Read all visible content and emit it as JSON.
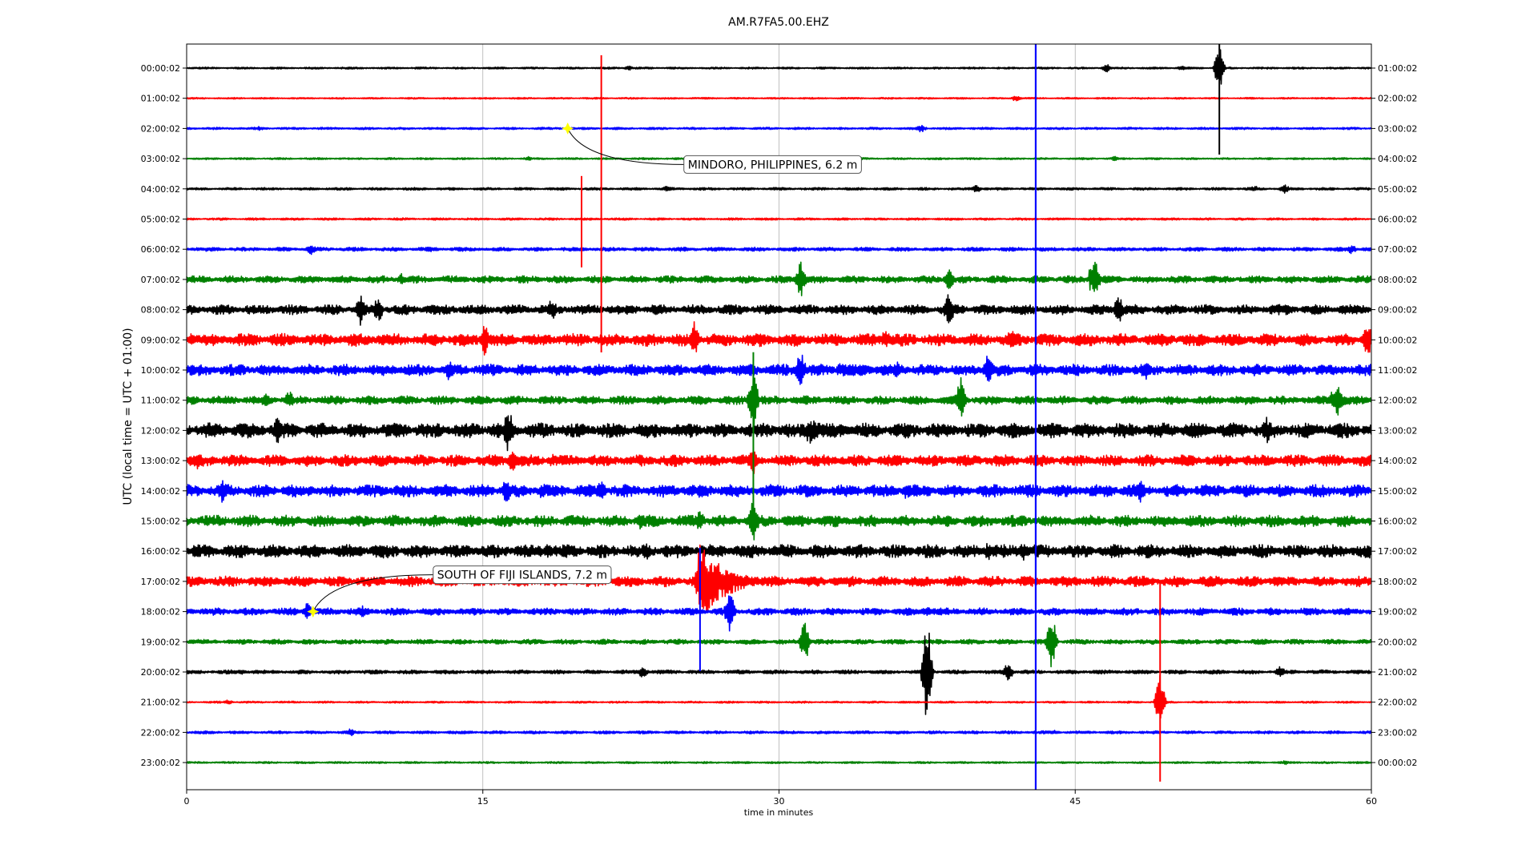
{
  "chart_data": {
    "type": "line",
    "title": "AM.R7FA5.00.EHZ",
    "xlabel": "time in minutes",
    "ylabel": "UTC (local time = UTC + 01:00)",
    "xlim": [
      0,
      60
    ],
    "x_ticks": [
      "0",
      "15",
      "30",
      "45",
      "60"
    ],
    "grid": "vertical",
    "colors": [
      "#000000",
      "#ff0000",
      "#0000ff",
      "#008000"
    ],
    "rows": [
      {
        "left": "00:00:02",
        "right": "01:00:02",
        "noise": 0.6,
        "spikes": [
          [
            22.4,
            3
          ],
          [
            46.6,
            5
          ],
          [
            50.4,
            3
          ],
          [
            52.3,
            28
          ]
        ]
      },
      {
        "left": "01:00:02",
        "right": "02:00:02",
        "noise": 0.5,
        "spikes": [
          [
            42.0,
            4
          ]
        ]
      },
      {
        "left": "02:00:02",
        "right": "03:00:02",
        "noise": 0.7,
        "spikes": [
          [
            3.7,
            3
          ],
          [
            37.2,
            5
          ]
        ]
      },
      {
        "left": "03:00:02",
        "right": "04:00:02",
        "noise": 0.6,
        "spikes": [
          [
            17.3,
            3
          ],
          [
            47.0,
            3
          ]
        ]
      },
      {
        "left": "04:00:02",
        "right": "05:00:02",
        "noise": 0.8,
        "spikes": [
          [
            24.3,
            4
          ],
          [
            40.0,
            5
          ],
          [
            54.1,
            4
          ],
          [
            55.6,
            6
          ]
        ]
      },
      {
        "left": "05:00:02",
        "right": "06:00:02",
        "noise": 0.7,
        "spikes": []
      },
      {
        "left": "06:00:02",
        "right": "07:00:02",
        "noise": 1.2,
        "spikes": [
          [
            6.3,
            7
          ],
          [
            12.3,
            4
          ],
          [
            59.0,
            6
          ]
        ]
      },
      {
        "left": "07:00:02",
        "right": "08:00:02",
        "noise": 2.2,
        "spikes": [
          [
            10.9,
            8
          ],
          [
            31.1,
            25
          ],
          [
            38.6,
            16
          ],
          [
            46.0,
            26
          ]
        ]
      },
      {
        "left": "08:00:02",
        "right": "09:00:02",
        "noise": 3.0,
        "spikes": [
          [
            8.8,
            20
          ],
          [
            9.7,
            18
          ],
          [
            18.5,
            16
          ],
          [
            38.6,
            25
          ],
          [
            47.2,
            20
          ],
          [
            55.7,
            8
          ]
        ]
      },
      {
        "left": "09:00:02",
        "right": "10:00:02",
        "noise": 3.8,
        "spikes": [
          [
            0.3,
            10
          ],
          [
            15.1,
            20
          ],
          [
            25.7,
            25
          ],
          [
            29.1,
            12
          ],
          [
            35.4,
            14
          ],
          [
            41.8,
            18
          ],
          [
            59.8,
            25
          ]
        ]
      },
      {
        "left": "10:00:02",
        "right": "11:00:02",
        "noise": 3.5,
        "spikes": [
          [
            13.3,
            14
          ],
          [
            31.1,
            25
          ],
          [
            36.0,
            12
          ],
          [
            40.6,
            22
          ],
          [
            48.6,
            12
          ]
        ]
      },
      {
        "left": "11:00:02",
        "right": "12:00:02",
        "noise": 2.6,
        "spikes": [
          [
            4.0,
            10
          ],
          [
            5.2,
            12
          ],
          [
            28.7,
            45
          ],
          [
            39.2,
            30
          ],
          [
            58.3,
            22
          ]
        ]
      },
      {
        "left": "12:00:02",
        "right": "13:00:02",
        "noise": 4.5,
        "spikes": [
          [
            4.6,
            18
          ],
          [
            16.3,
            30
          ],
          [
            31.6,
            18
          ],
          [
            54.7,
            18
          ]
        ]
      },
      {
        "left": "13:00:02",
        "right": "14:00:02",
        "noise": 3.5,
        "spikes": [
          [
            0.5,
            12
          ],
          [
            16.5,
            16
          ],
          [
            28.7,
            18
          ]
        ]
      },
      {
        "left": "14:00:02",
        "right": "15:00:02",
        "noise": 3.8,
        "spikes": [
          [
            1.8,
            16
          ],
          [
            16.2,
            18
          ],
          [
            21.0,
            14
          ],
          [
            48.3,
            18
          ]
        ]
      },
      {
        "left": "15:00:02",
        "right": "16:00:02",
        "noise": 3.5,
        "spikes": [
          [
            23.0,
            12
          ],
          [
            26.0,
            14
          ],
          [
            28.7,
            30
          ]
        ]
      },
      {
        "left": "16:00:02",
        "right": "17:00:02",
        "noise": 4.0,
        "spikes": [
          [
            18.3,
            10
          ],
          [
            23.3,
            12
          ],
          [
            40.6,
            12
          ],
          [
            42.4,
            14
          ]
        ]
      },
      {
        "left": "17:00:02",
        "right": "18:00:02",
        "noise": 3.2,
        "spikes": [
          [
            26.0,
            35
          ],
          [
            26.7,
            14
          ]
        ]
      },
      {
        "left": "18:00:02",
        "right": "19:00:02",
        "noise": 2.2,
        "spikes": [
          [
            6.1,
            12
          ],
          [
            8.9,
            8
          ],
          [
            27.5,
            30
          ],
          [
            37.5,
            8
          ]
        ]
      },
      {
        "left": "19:00:02",
        "right": "20:00:02",
        "noise": 1.5,
        "spikes": [
          [
            31.3,
            28
          ],
          [
            43.8,
            38
          ]
        ]
      },
      {
        "left": "20:00:02",
        "right": "21:00:02",
        "noise": 1.2,
        "spikes": [
          [
            2.8,
            4
          ],
          [
            23.1,
            8
          ],
          [
            37.5,
            70
          ],
          [
            41.6,
            12
          ],
          [
            55.4,
            8
          ]
        ]
      },
      {
        "left": "21:00:02",
        "right": "22:00:02",
        "noise": 0.6,
        "spikes": [
          [
            2.1,
            3
          ],
          [
            49.3,
            38
          ]
        ]
      },
      {
        "left": "22:00:02",
        "right": "23:00:02",
        "noise": 0.9,
        "spikes": [
          [
            8.3,
            5
          ],
          [
            44.0,
            3
          ]
        ]
      },
      {
        "left": "23:00:02",
        "right": "00:00:02",
        "noise": 0.6,
        "spikes": [
          [
            55.6,
            3
          ]
        ]
      }
    ],
    "long_spikes": [
      {
        "row": 0,
        "x": 21.0,
        "up": 16,
        "down": 355,
        "color": "#ff0000"
      },
      {
        "row": 4,
        "x": 20.0,
        "up": 16,
        "down": 98,
        "color": "#ff0000"
      },
      {
        "row": 0,
        "x": 52.3,
        "up": 30,
        "down": 108,
        "color": "#000000"
      },
      {
        "row": 17,
        "x": 26.0,
        "up": 42,
        "down": 112,
        "color": "#0000ff"
      },
      {
        "row": 17,
        "x": 49.3,
        "up": 0,
        "down": 250,
        "color": "#ff0000"
      },
      {
        "row": 11,
        "x": 28.7,
        "up": 60,
        "down": 150,
        "color": "#008000"
      }
    ],
    "bursts": [
      {
        "row": 17,
        "x": 26.0,
        "width": 3.5,
        "amp": 55
      },
      {
        "row": 12,
        "x": 31.5,
        "width": 5.5,
        "amp": 14
      },
      {
        "row": 10,
        "x": 33.0,
        "width": 8.0,
        "amp": 9
      },
      {
        "row": 11,
        "x": 58.0,
        "width": 2.5,
        "amp": 12
      },
      {
        "row": 13,
        "x": 18.5,
        "width": 4.0,
        "amp": 8
      },
      {
        "row": 14,
        "x": 18.0,
        "width": 3.0,
        "amp": 10
      },
      {
        "row": 14,
        "x": 36.5,
        "width": 2.5,
        "amp": 10
      },
      {
        "row": 7,
        "x": 45.8,
        "width": 1.0,
        "amp": 14
      }
    ],
    "vertical_line": {
      "x": 43.0,
      "color": "#0000ff"
    },
    "annotations": [
      {
        "label": "MINDORO, PHILIPPINES, 6.2 m",
        "row": 2,
        "x": 19.3
      },
      {
        "label": "SOUTH OF FIJI ISLANDS, 7.2 m",
        "row": 18,
        "x": 6.4
      }
    ],
    "marker_color": "#ffff00"
  }
}
